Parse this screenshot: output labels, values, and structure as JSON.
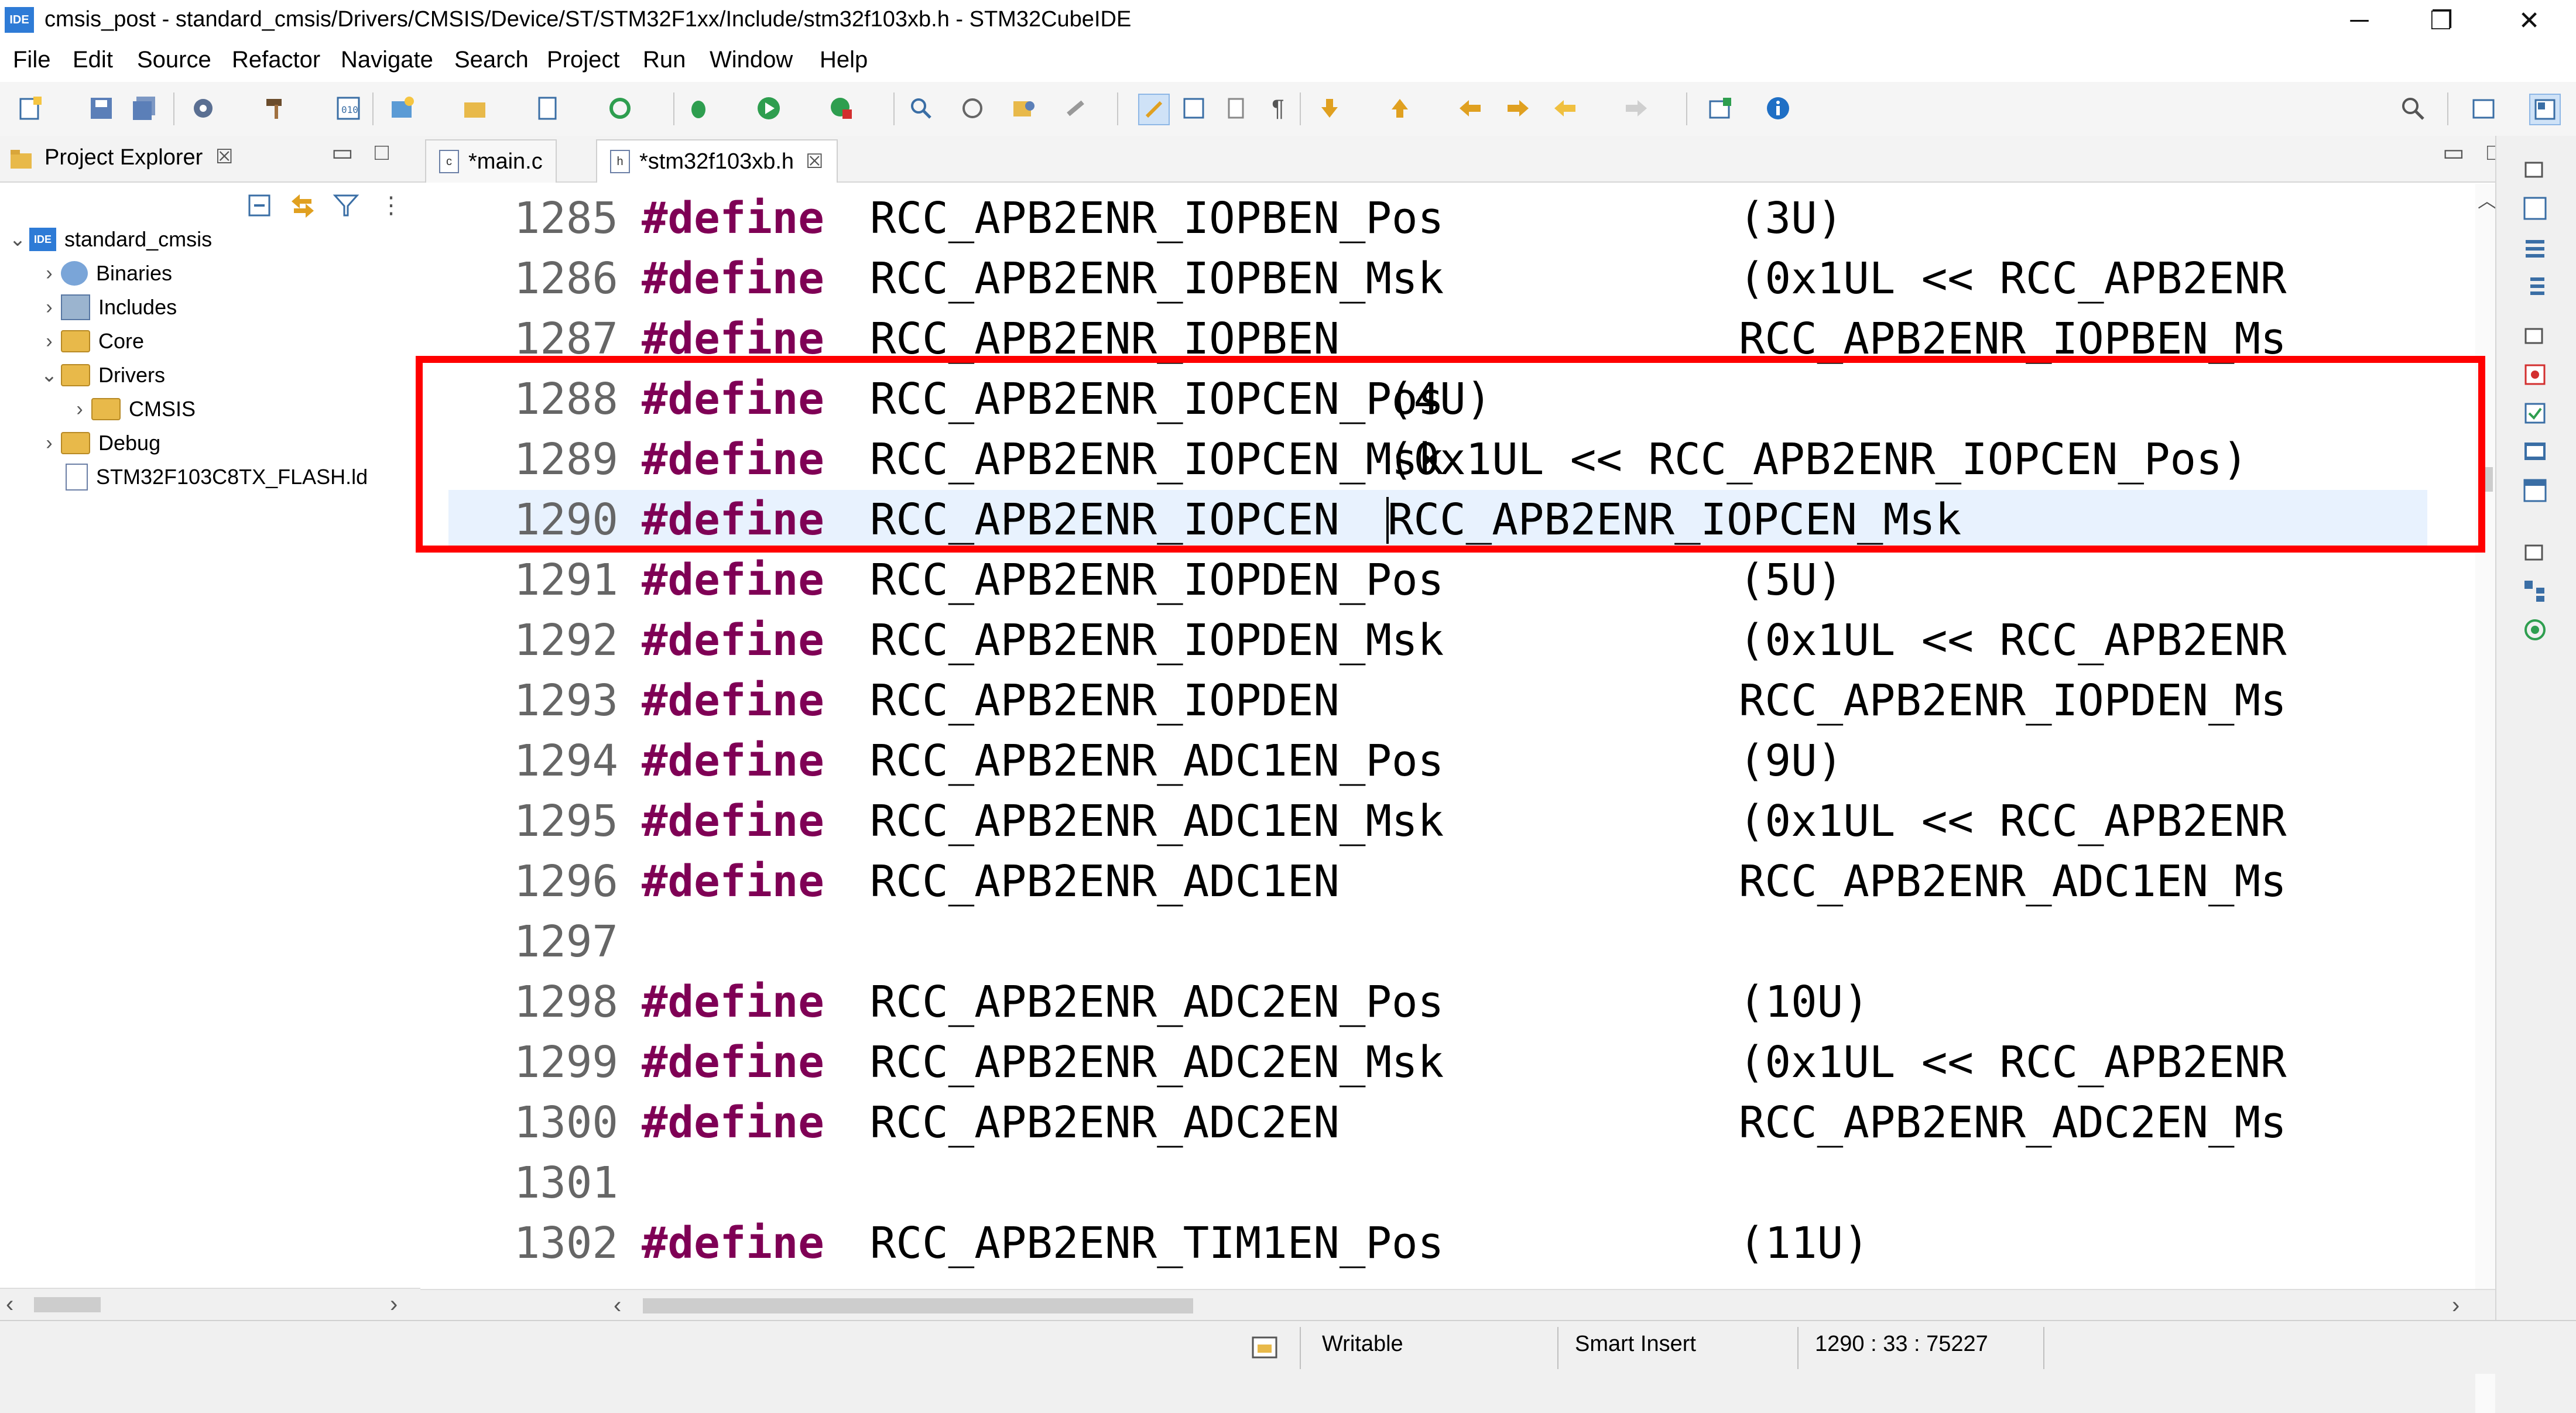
{
  "window": {
    "app_badge": "IDE",
    "title": "cmsis_post - standard_cmsis/Drivers/CMSIS/Device/ST/STM32F1xx/Include/stm32f103xb.h - STM32CubeIDE",
    "controls": {
      "minimize": "─",
      "restore": "❐",
      "close": "✕"
    }
  },
  "menu": [
    "File",
    "Edit",
    "Source",
    "Refactor",
    "Navigate",
    "Search",
    "Project",
    "Run",
    "Window",
    "Help"
  ],
  "explorer": {
    "tab_label": "Project Explorer",
    "tab_close": "☒",
    "project": "standard_cmsis",
    "items": [
      "Binaries",
      "Includes",
      "Core",
      "Drivers",
      "CMSIS",
      "Debug",
      "STM32F103C8TX_FLASH.ld"
    ]
  },
  "editor": {
    "tabs": [
      {
        "label": "*main.c",
        "icon_text": "c"
      },
      {
        "label": "*stm32f103xb.h",
        "icon_text": "h",
        "close": "☒"
      }
    ],
    "keyword": "#define",
    "lines": [
      {
        "num": "1285",
        "name": "RCC_APB2ENR_IOPBEN_Pos",
        "value": "(3U)"
      },
      {
        "num": "1286",
        "name": "RCC_APB2ENR_IOPBEN_Msk",
        "value": "(0x1UL << RCC_APB2ENR"
      },
      {
        "num": "1287",
        "name": "RCC_APB2ENR_IOPBEN",
        "value": "RCC_APB2ENR_IOPBEN_Ms"
      },
      {
        "num": "1288",
        "name": "RCC_APB2ENR_IOPCEN_Pos",
        "value": "(4U)"
      },
      {
        "num": "1289",
        "name": "RCC_APB2ENR_IOPCEN_Msk",
        "value": "(0x1UL << RCC_APB2ENR_IOPCEN_Pos)"
      },
      {
        "num": "1290",
        "name": "RCC_APB2ENR_IOPCEN",
        "value": "RCC_APB2ENR_IOPCEN_Msk"
      },
      {
        "num": "1291",
        "name": "RCC_APB2ENR_IOPDEN_Pos",
        "value": "(5U)"
      },
      {
        "num": "1292",
        "name": "RCC_APB2ENR_IOPDEN_Msk",
        "value": "(0x1UL << RCC_APB2ENR"
      },
      {
        "num": "1293",
        "name": "RCC_APB2ENR_IOPDEN",
        "value": "RCC_APB2ENR_IOPDEN_Ms"
      },
      {
        "num": "1294",
        "name": "RCC_APB2ENR_ADC1EN_Pos",
        "value": "(9U)"
      },
      {
        "num": "1295",
        "name": "RCC_APB2ENR_ADC1EN_Msk",
        "value": "(0x1UL << RCC_APB2ENR"
      },
      {
        "num": "1296",
        "name": "RCC_APB2ENR_ADC1EN",
        "value": "RCC_APB2ENR_ADC1EN_Ms"
      },
      {
        "num": "1297",
        "name": "",
        "value": ""
      },
      {
        "num": "1298",
        "name": "RCC_APB2ENR_ADC2EN_Pos",
        "value": "(10U)"
      },
      {
        "num": "1299",
        "name": "RCC_APB2ENR_ADC2EN_Msk",
        "value": "(0x1UL << RCC_APB2ENR"
      },
      {
        "num": "1300",
        "name": "RCC_APB2ENR_ADC2EN",
        "value": "RCC_APB2ENR_ADC2EN_Ms"
      },
      {
        "num": "1301",
        "name": "",
        "value": ""
      },
      {
        "num": "1302",
        "name": "RCC_APB2ENR_TIM1EN_Pos",
        "value": "(11U)"
      }
    ]
  },
  "status": {
    "mode": "Writable",
    "insert": "Smart Insert",
    "position": "1290 : 33 : 75227"
  }
}
